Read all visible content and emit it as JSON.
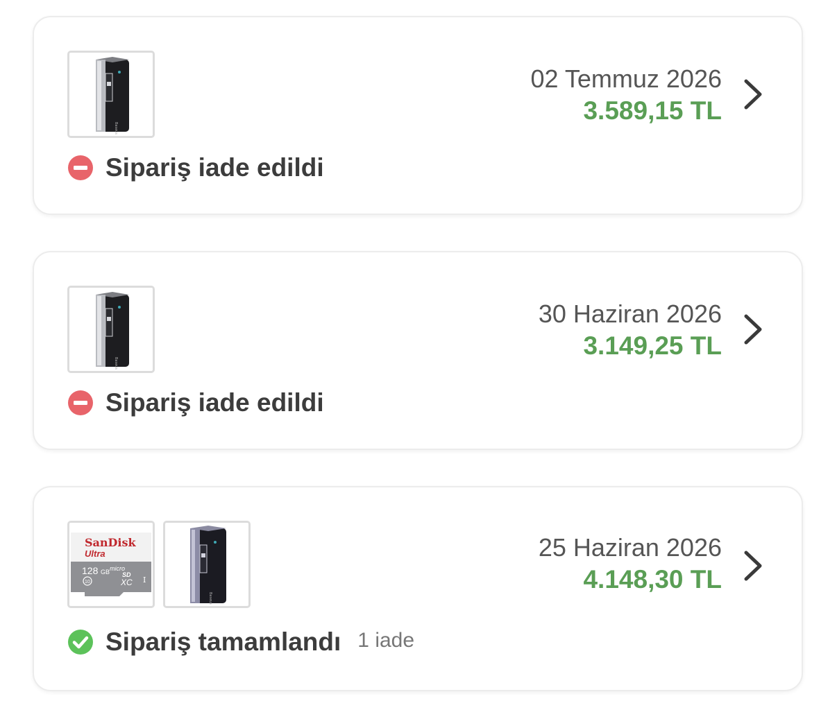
{
  "orders": [
    {
      "date": "02 Temmuz 2026",
      "total": "3.589,15 TL",
      "status": "Sipariş iade edildi",
      "status_type": "returned",
      "status_color": "#e8646a",
      "products": [
        "powerbank"
      ]
    },
    {
      "date": "30 Haziran 2026",
      "total": "3.149,25 TL",
      "status": "Sipariş iade edildi",
      "status_type": "returned",
      "status_color": "#e8646a",
      "products": [
        "powerbank"
      ]
    },
    {
      "date": "25 Haziran 2026",
      "total": "4.148,30 TL",
      "status": "Sipariş tamamlandı",
      "status_type": "completed",
      "status_color": "#5cc25a",
      "return_count": "1 iade",
      "products": [
        "sandisk-microsd",
        "powerbank"
      ]
    }
  ],
  "sandisk": {
    "brand": "SanDisk",
    "line": "Ultra",
    "capacity": "128",
    "unit": "GB",
    "format_top": "micro",
    "format_mid": "SD",
    "format_bot": "XC",
    "class": "10",
    "uhs": "I"
  },
  "colors": {
    "price_green": "#5a9e55",
    "date_gray": "#555555",
    "card_border": "#ececec"
  },
  "icons": [
    "chevron-right-icon",
    "minus-circle-icon",
    "check-circle-icon"
  ]
}
